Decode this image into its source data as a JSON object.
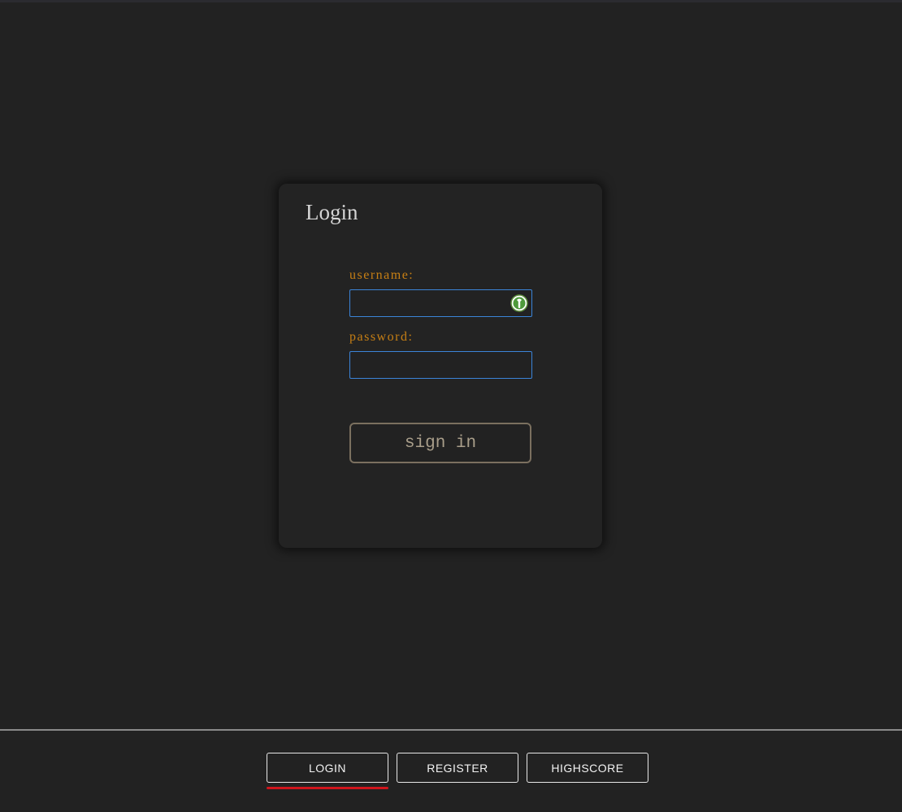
{
  "login_card": {
    "title": "Login",
    "username_label": "username:",
    "username_value": "",
    "password_label": "password:",
    "password_value": "",
    "signin_label": "sign in",
    "password_manager_icon": "password-manager-icon"
  },
  "nav": {
    "items": [
      {
        "label": "LOGIN",
        "active": true
      },
      {
        "label": "REGISTER",
        "active": false
      },
      {
        "label": "HIGHSCORE",
        "active": false
      }
    ]
  },
  "colors": {
    "background": "#222222",
    "label_accent": "#c77f14",
    "input_border": "#3b84d8",
    "active_indicator": "#d0151c"
  }
}
